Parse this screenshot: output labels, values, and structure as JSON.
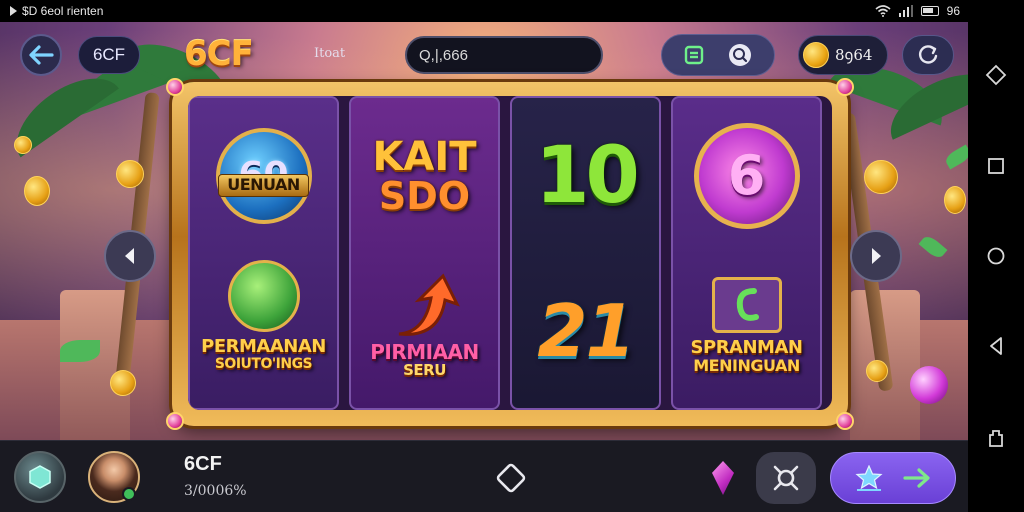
{
  "status_bar": {
    "left_text": "$D 6eol rienten",
    "right_text": "96"
  },
  "top_bar": {
    "logo_text": "6CF",
    "brand_title": "6CF",
    "label": "Itoat",
    "search": {
      "value": "Q,|,666"
    },
    "coins": "8ꝯ64"
  },
  "reels": [
    {
      "top": {
        "number": "60",
        "banner": "UENUAN"
      },
      "bottom": {
        "line1": "PERMAANAN",
        "line2": "SOIUTO'INGS"
      }
    },
    {
      "top": {
        "line1": "KAIT",
        "line2": "SDO"
      },
      "bottom": {
        "line1": "PIRMIAAN",
        "line2": "SERU"
      }
    },
    {
      "top": {
        "number": "10"
      },
      "bottom": {
        "number": "21"
      }
    },
    {
      "top": {
        "number": "6"
      },
      "bottom": {
        "line1": "SPRANMAN",
        "line2": "MENINGUAN"
      }
    }
  ],
  "player": {
    "name": "6CF",
    "score": "3/0006%"
  },
  "colors": {
    "accent_purple": "#7a52d8",
    "gold": "#ffd15a",
    "frame_gold": "#d99b3c"
  }
}
